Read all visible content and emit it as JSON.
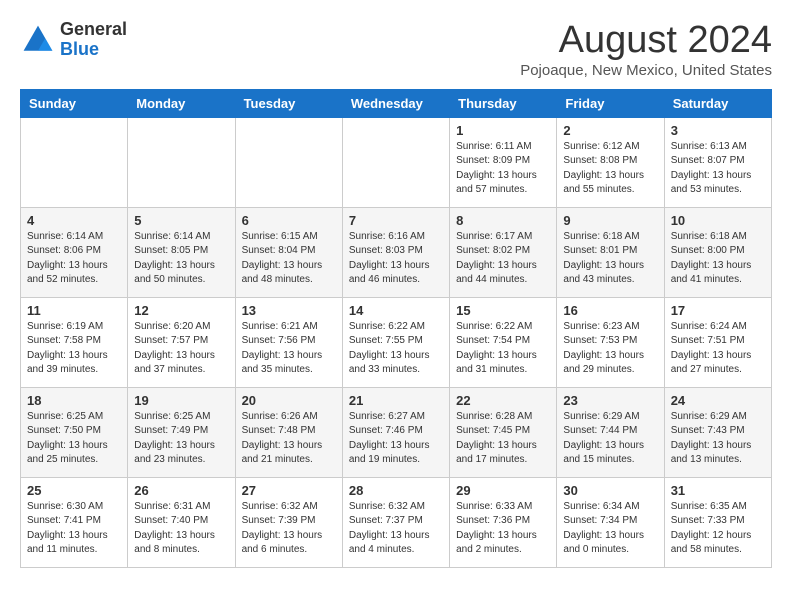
{
  "header": {
    "logo_line1": "General",
    "logo_line2": "Blue",
    "month": "August 2024",
    "location": "Pojoaque, New Mexico, United States"
  },
  "weekdays": [
    "Sunday",
    "Monday",
    "Tuesday",
    "Wednesday",
    "Thursday",
    "Friday",
    "Saturday"
  ],
  "weeks": [
    [
      {
        "day": "",
        "info": ""
      },
      {
        "day": "",
        "info": ""
      },
      {
        "day": "",
        "info": ""
      },
      {
        "day": "",
        "info": ""
      },
      {
        "day": "1",
        "info": "Sunrise: 6:11 AM\nSunset: 8:09 PM\nDaylight: 13 hours\nand 57 minutes."
      },
      {
        "day": "2",
        "info": "Sunrise: 6:12 AM\nSunset: 8:08 PM\nDaylight: 13 hours\nand 55 minutes."
      },
      {
        "day": "3",
        "info": "Sunrise: 6:13 AM\nSunset: 8:07 PM\nDaylight: 13 hours\nand 53 minutes."
      }
    ],
    [
      {
        "day": "4",
        "info": "Sunrise: 6:14 AM\nSunset: 8:06 PM\nDaylight: 13 hours\nand 52 minutes."
      },
      {
        "day": "5",
        "info": "Sunrise: 6:14 AM\nSunset: 8:05 PM\nDaylight: 13 hours\nand 50 minutes."
      },
      {
        "day": "6",
        "info": "Sunrise: 6:15 AM\nSunset: 8:04 PM\nDaylight: 13 hours\nand 48 minutes."
      },
      {
        "day": "7",
        "info": "Sunrise: 6:16 AM\nSunset: 8:03 PM\nDaylight: 13 hours\nand 46 minutes."
      },
      {
        "day": "8",
        "info": "Sunrise: 6:17 AM\nSunset: 8:02 PM\nDaylight: 13 hours\nand 44 minutes."
      },
      {
        "day": "9",
        "info": "Sunrise: 6:18 AM\nSunset: 8:01 PM\nDaylight: 13 hours\nand 43 minutes."
      },
      {
        "day": "10",
        "info": "Sunrise: 6:18 AM\nSunset: 8:00 PM\nDaylight: 13 hours\nand 41 minutes."
      }
    ],
    [
      {
        "day": "11",
        "info": "Sunrise: 6:19 AM\nSunset: 7:58 PM\nDaylight: 13 hours\nand 39 minutes."
      },
      {
        "day": "12",
        "info": "Sunrise: 6:20 AM\nSunset: 7:57 PM\nDaylight: 13 hours\nand 37 minutes."
      },
      {
        "day": "13",
        "info": "Sunrise: 6:21 AM\nSunset: 7:56 PM\nDaylight: 13 hours\nand 35 minutes."
      },
      {
        "day": "14",
        "info": "Sunrise: 6:22 AM\nSunset: 7:55 PM\nDaylight: 13 hours\nand 33 minutes."
      },
      {
        "day": "15",
        "info": "Sunrise: 6:22 AM\nSunset: 7:54 PM\nDaylight: 13 hours\nand 31 minutes."
      },
      {
        "day": "16",
        "info": "Sunrise: 6:23 AM\nSunset: 7:53 PM\nDaylight: 13 hours\nand 29 minutes."
      },
      {
        "day": "17",
        "info": "Sunrise: 6:24 AM\nSunset: 7:51 PM\nDaylight: 13 hours\nand 27 minutes."
      }
    ],
    [
      {
        "day": "18",
        "info": "Sunrise: 6:25 AM\nSunset: 7:50 PM\nDaylight: 13 hours\nand 25 minutes."
      },
      {
        "day": "19",
        "info": "Sunrise: 6:25 AM\nSunset: 7:49 PM\nDaylight: 13 hours\nand 23 minutes."
      },
      {
        "day": "20",
        "info": "Sunrise: 6:26 AM\nSunset: 7:48 PM\nDaylight: 13 hours\nand 21 minutes."
      },
      {
        "day": "21",
        "info": "Sunrise: 6:27 AM\nSunset: 7:46 PM\nDaylight: 13 hours\nand 19 minutes."
      },
      {
        "day": "22",
        "info": "Sunrise: 6:28 AM\nSunset: 7:45 PM\nDaylight: 13 hours\nand 17 minutes."
      },
      {
        "day": "23",
        "info": "Sunrise: 6:29 AM\nSunset: 7:44 PM\nDaylight: 13 hours\nand 15 minutes."
      },
      {
        "day": "24",
        "info": "Sunrise: 6:29 AM\nSunset: 7:43 PM\nDaylight: 13 hours\nand 13 minutes."
      }
    ],
    [
      {
        "day": "25",
        "info": "Sunrise: 6:30 AM\nSunset: 7:41 PM\nDaylight: 13 hours\nand 11 minutes."
      },
      {
        "day": "26",
        "info": "Sunrise: 6:31 AM\nSunset: 7:40 PM\nDaylight: 13 hours\nand 8 minutes."
      },
      {
        "day": "27",
        "info": "Sunrise: 6:32 AM\nSunset: 7:39 PM\nDaylight: 13 hours\nand 6 minutes."
      },
      {
        "day": "28",
        "info": "Sunrise: 6:32 AM\nSunset: 7:37 PM\nDaylight: 13 hours\nand 4 minutes."
      },
      {
        "day": "29",
        "info": "Sunrise: 6:33 AM\nSunset: 7:36 PM\nDaylight: 13 hours\nand 2 minutes."
      },
      {
        "day": "30",
        "info": "Sunrise: 6:34 AM\nSunset: 7:34 PM\nDaylight: 13 hours\nand 0 minutes."
      },
      {
        "day": "31",
        "info": "Sunrise: 6:35 AM\nSunset: 7:33 PM\nDaylight: 12 hours\nand 58 minutes."
      }
    ]
  ]
}
